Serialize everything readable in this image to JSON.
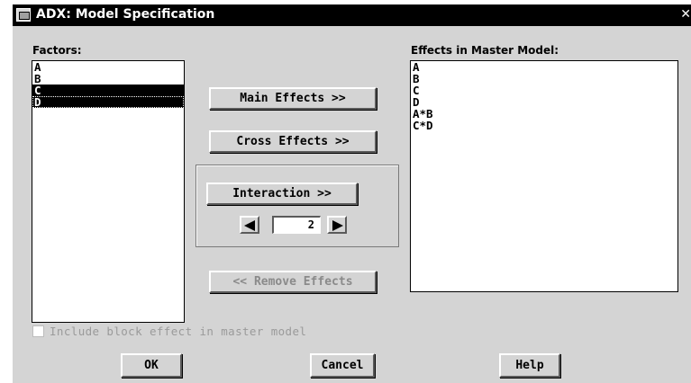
{
  "window": {
    "title": "ADX: Model Specification",
    "close_glyph": "✕"
  },
  "factors": {
    "label": "Factors:",
    "items": [
      {
        "label": "A",
        "selected": false
      },
      {
        "label": "B",
        "selected": false
      },
      {
        "label": "C",
        "selected": true
      },
      {
        "label": "D",
        "selected": true
      }
    ]
  },
  "effects": {
    "label": "Effects in Master Model:",
    "items": [
      "A",
      "B",
      "C",
      "D",
      "A*B",
      "C*D"
    ]
  },
  "buttons": {
    "main_effects": "Main Effects >>",
    "cross_effects": "Cross Effects >>",
    "interaction": "Interaction >>",
    "remove_effects": "<< Remove Effects",
    "ok": "OK",
    "cancel": "Cancel",
    "help": "Help"
  },
  "interaction_order": {
    "value": "2"
  },
  "block_effect": {
    "label": "Include block effect in master model",
    "checked": false,
    "enabled": false
  },
  "icons": {
    "window": "window-app-icon",
    "close": "close-icon",
    "decrement": "arrow-left-icon",
    "increment": "arrow-right-icon"
  },
  "colors": {
    "dialog_background": "#d4d4d4",
    "titlebar": "#000000",
    "selection": "#000000",
    "disabled_text": "#8a8a8a"
  }
}
